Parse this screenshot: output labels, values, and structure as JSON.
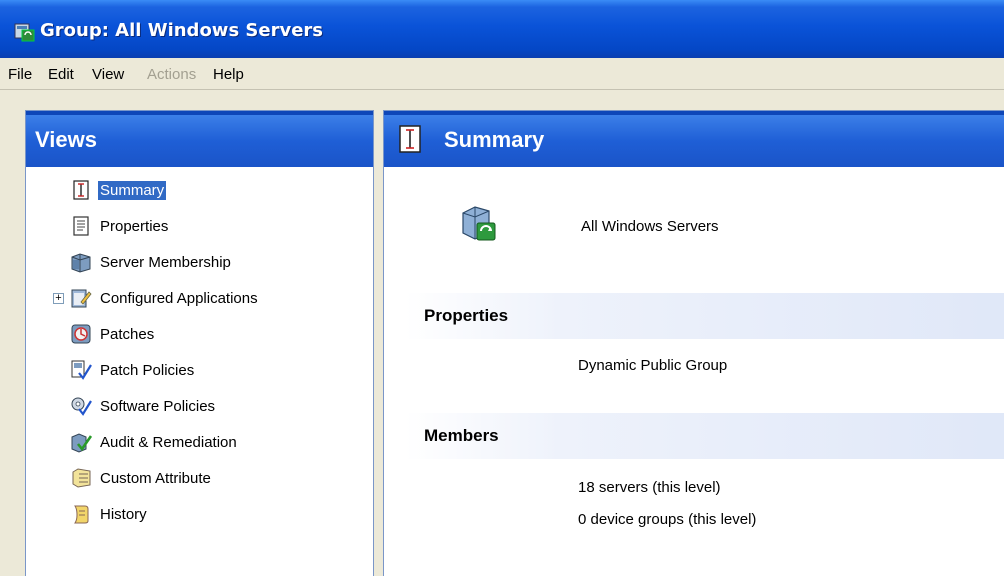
{
  "window": {
    "title": "Group: All Windows Servers"
  },
  "menu": {
    "items": [
      {
        "label": "File",
        "enabled": true
      },
      {
        "label": "Edit",
        "enabled": true
      },
      {
        "label": "View",
        "enabled": true
      },
      {
        "label": "Actions",
        "enabled": false
      },
      {
        "label": "Help",
        "enabled": true
      }
    ]
  },
  "views_panel": {
    "title": "Views",
    "items": [
      {
        "label": "Summary",
        "icon": "summary-icon",
        "selected": true
      },
      {
        "label": "Properties",
        "icon": "properties-icon"
      },
      {
        "label": "Server Membership",
        "icon": "server-membership-icon"
      },
      {
        "label": "Configured Applications",
        "icon": "configured-applications-icon",
        "expandable": true
      },
      {
        "label": "Patches",
        "icon": "patches-icon"
      },
      {
        "label": "Patch Policies",
        "icon": "patch-policies-icon"
      },
      {
        "label": "Software Policies",
        "icon": "software-policies-icon"
      },
      {
        "label": "Audit & Remediation",
        "icon": "audit-remediation-icon"
      },
      {
        "label": "Custom Attribute",
        "icon": "custom-attribute-icon"
      },
      {
        "label": "History",
        "icon": "history-icon"
      }
    ]
  },
  "summary": {
    "title": "Summary",
    "group_name": "All Windows Servers",
    "properties_header": "Properties",
    "properties_value": "Dynamic Public Group",
    "members_header": "Members",
    "members_servers": "18 servers (this level)",
    "members_device_groups": "0 device groups (this level)"
  },
  "colors": {
    "title_bar": "#0a53d8",
    "panel_header": "#1f5fd6",
    "selection": "#316ac5"
  }
}
